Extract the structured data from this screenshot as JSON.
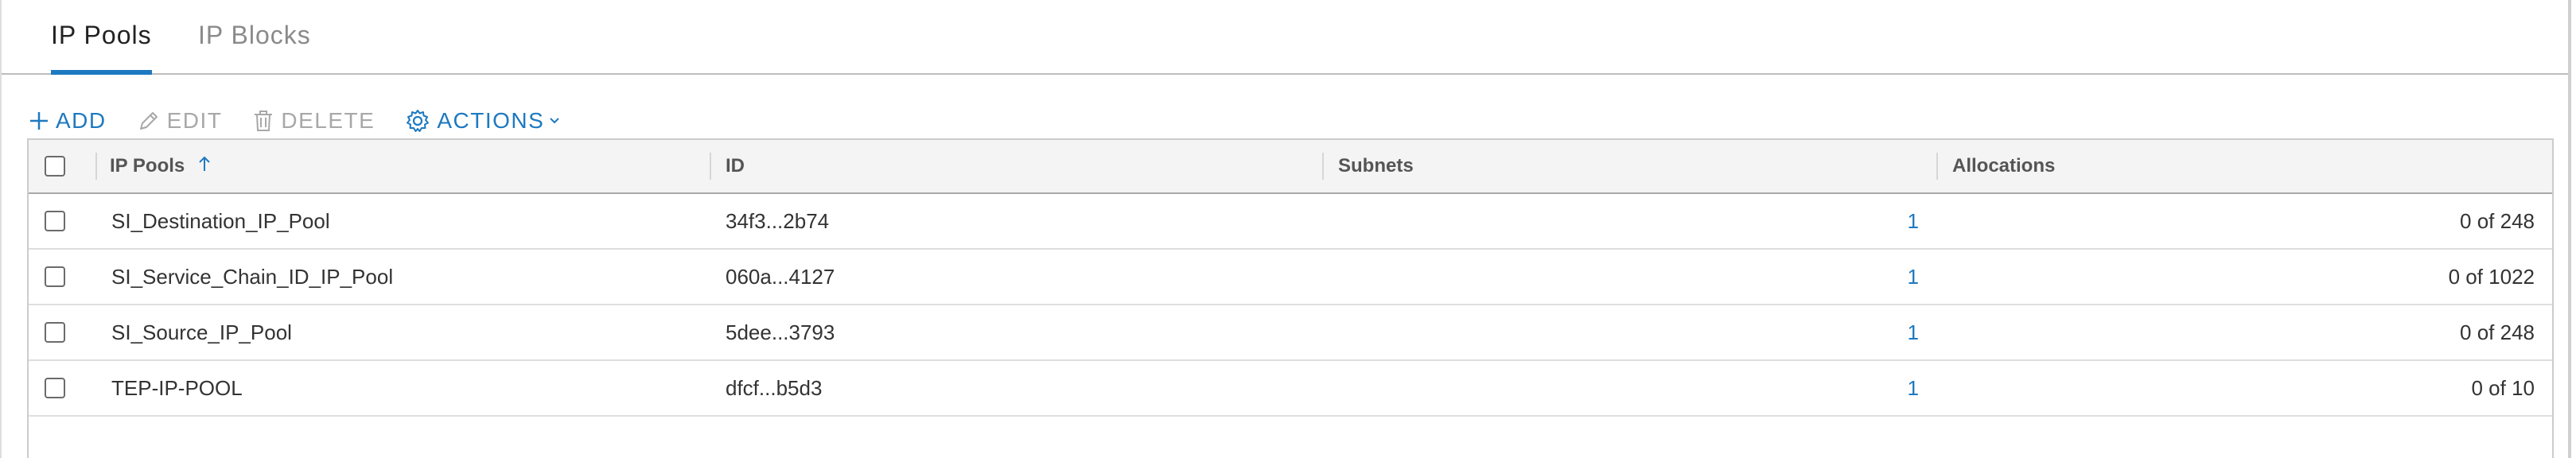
{
  "tabs": [
    {
      "label": "IP Pools",
      "active": true
    },
    {
      "label": "IP Blocks",
      "active": false
    }
  ],
  "toolbar": {
    "add_label": "ADD",
    "edit_label": "EDIT",
    "delete_label": "DELETE",
    "actions_label": "ACTIONS",
    "icons": {
      "add": "plus-icon",
      "edit": "pencil-icon",
      "delete": "trash-icon",
      "actions": "gear-icon",
      "actions_menu": "chevron-down-icon"
    }
  },
  "table": {
    "columns": [
      "IP Pools",
      "ID",
      "Subnets",
      "Allocations"
    ],
    "sort": {
      "column": "IP Pools",
      "direction": "ascending",
      "icon": "sort-up-arrow-icon"
    },
    "rows": [
      {
        "name": "SI_Destination_IP_Pool",
        "id": "34f3...2b74",
        "subnets": "1",
        "allocations": "0 of 248"
      },
      {
        "name": "SI_Service_Chain_ID_IP_Pool",
        "id": "060a...4127",
        "subnets": "1",
        "allocations": "0 of 1022"
      },
      {
        "name": "SI_Source_IP_Pool",
        "id": "5dee...3793",
        "subnets": "1",
        "allocations": "0 of 248"
      },
      {
        "name": "TEP-IP-POOL",
        "id": "dfcf...b5d3",
        "subnets": "1",
        "allocations": "0 of 10"
      }
    ]
  },
  "colors": {
    "accent": "#1d79c0",
    "header_bg": "#f4f4f4",
    "disabled_text": "#a8a8a8"
  }
}
